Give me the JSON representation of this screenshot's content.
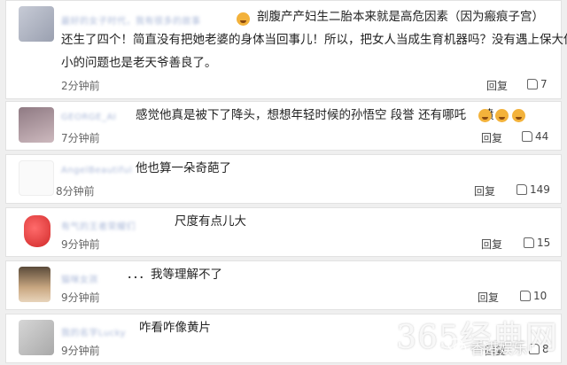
{
  "comments": [
    {
      "username": "最好的女子时代，我有很多的故事",
      "text_lines": [
        "剖腹产产妇生二胎本来就是高危因素（因为瘢痕子宫）",
        "还生了四个！简直没有把她老婆的身体当回事儿！所以，把女人当成生育机器吗？没有遇上保大保",
        "小的问题也是老天爷善良了。"
      ],
      "time": "2分钟前",
      "reply": "回复",
      "likes": "7"
    },
    {
      "username": "GEORGE_AI",
      "text_lines": [
        "感觉他真是被下了降头，想想年轻时候的孙悟空 段誉 还有哪吒　 喷"
      ],
      "time": "7分钟前",
      "reply": "回复",
      "likes": "44"
    },
    {
      "username": "AngelBeautiful",
      "text_lines": [
        "他也算一朵奇葩了"
      ],
      "time": "8分钟前",
      "reply": "回复",
      "likes": "149"
    },
    {
      "username": "有气的王者荣耀们",
      "text_lines": [
        "尺度有点儿大"
      ],
      "time": "9分钟前",
      "reply": "回复",
      "likes": "15"
    },
    {
      "username": "猫咪女孩",
      "text_lines": [
        "．．．我等理解不了"
      ],
      "time": "9分钟前",
      "reply": "回复",
      "likes": "10"
    },
    {
      "username": "我的名字Lucky",
      "text_lines": [
        "咋看咋像黄片"
      ],
      "time": "9分钟前",
      "reply": "回复",
      "likes": "8"
    }
  ],
  "watermark": "365经典网",
  "wechat_label": "香港娱乐",
  "colors": {
    "username": "#aab8d8",
    "card": "#ffffff",
    "bg": "#efefef"
  }
}
